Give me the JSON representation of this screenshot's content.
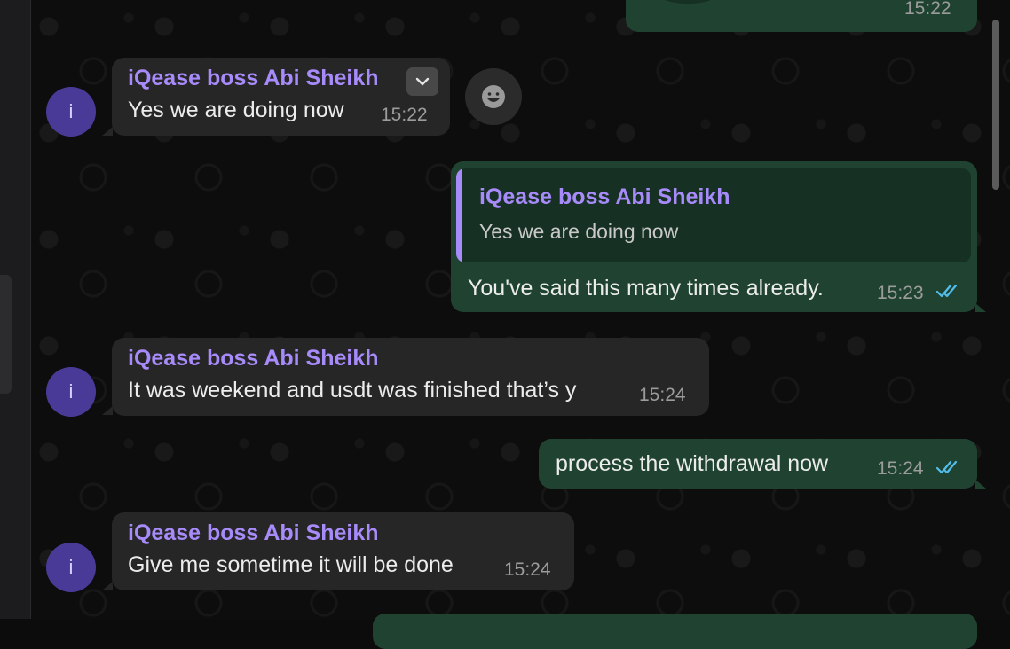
{
  "contact": {
    "name": "iQease boss Abi Sheikh",
    "avatar_initial": "i"
  },
  "messages": [
    {
      "direction": "outgoing",
      "time": "15:22",
      "partial": true
    },
    {
      "direction": "incoming",
      "sender": "iQease boss Abi Sheikh",
      "text": "Yes we are doing now",
      "time": "15:22"
    },
    {
      "direction": "outgoing",
      "quote": {
        "sender": "iQease boss Abi Sheikh",
        "text": "Yes we are doing now"
      },
      "text": "You've said this many times already.",
      "time": "15:23",
      "status": "read"
    },
    {
      "direction": "incoming",
      "sender": "iQease boss Abi Sheikh",
      "text": "It was weekend and usdt was finished that’s y",
      "time": "15:24"
    },
    {
      "direction": "outgoing",
      "text": "process the withdrawal now",
      "time": "15:24",
      "status": "read"
    },
    {
      "direction": "incoming",
      "sender": "iQease boss Abi Sheikh",
      "text": "Give me sometime it will be done",
      "time": "15:24"
    }
  ],
  "icons": {
    "message_menu": "chevron-down-icon",
    "reaction": "smiley-icon",
    "read_receipt": "double-check-icon"
  },
  "colors": {
    "incoming_bubble": "#262626",
    "outgoing_bubble": "#1f4330",
    "sender_name": "#a88bfa",
    "read_ticks": "#53bdeb"
  }
}
